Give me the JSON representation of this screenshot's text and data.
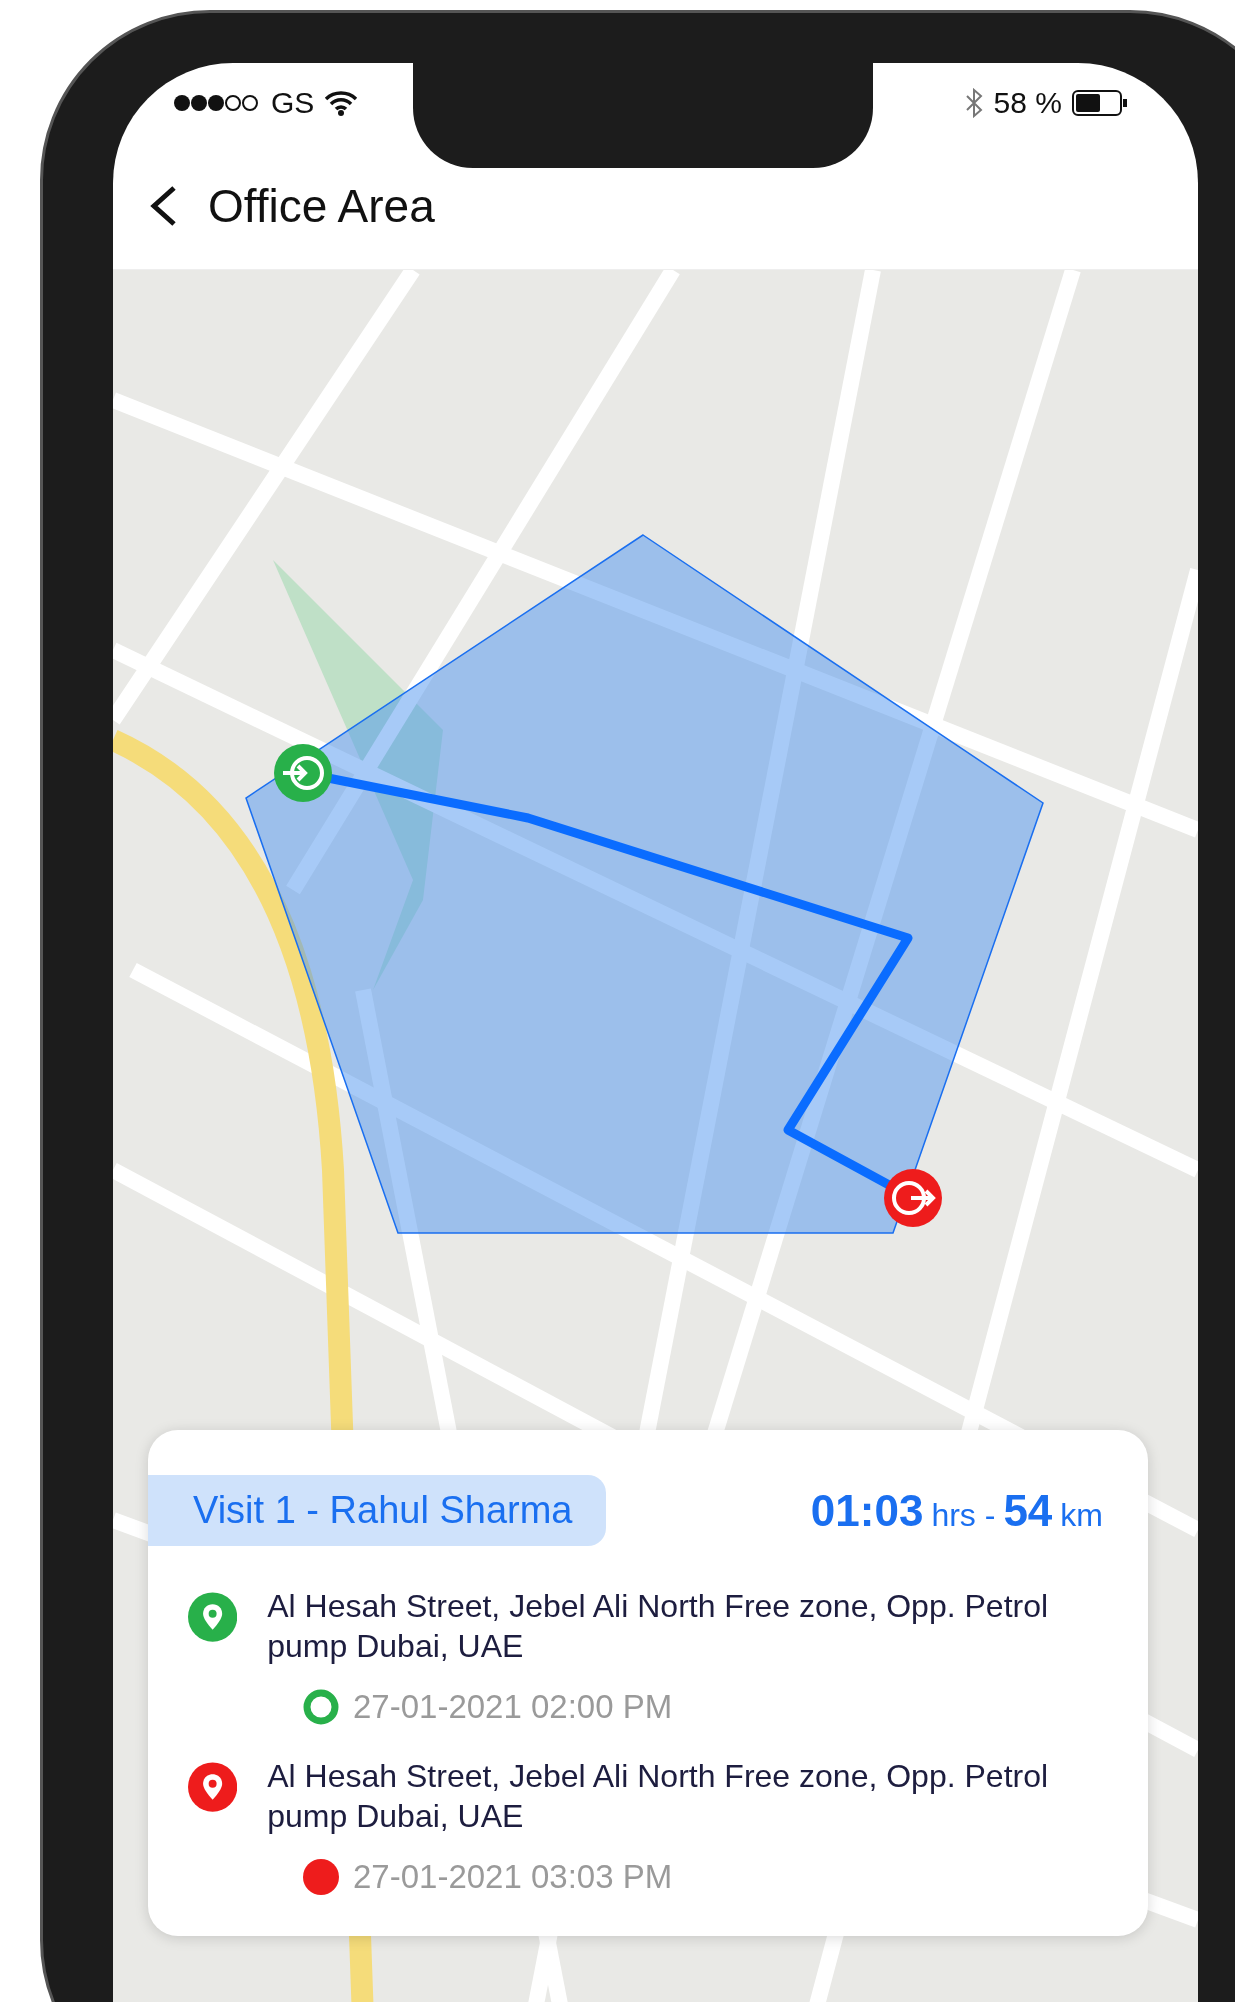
{
  "status_bar": {
    "carrier": "GS",
    "battery": "58 %"
  },
  "header": {
    "title": "Office Area"
  },
  "visit": {
    "title": "Visit 1 - Rahul Sharma",
    "duration": "01:03",
    "duration_unit": "hrs -",
    "distance": "54",
    "distance_unit": "km"
  },
  "stops": [
    {
      "kind": "start",
      "address": "Al Hesah Street, Jebel Ali North Free zone,  Opp. Petrol pump Dubai, UAE",
      "time": "27-01-2021 02:00 PM"
    },
    {
      "kind": "end",
      "address": "Al Hesah Street, Jebel Ali North Free zone,  Opp. Petrol pump Dubai, UAE",
      "time": "27-01-2021 03:03 PM"
    }
  ]
}
